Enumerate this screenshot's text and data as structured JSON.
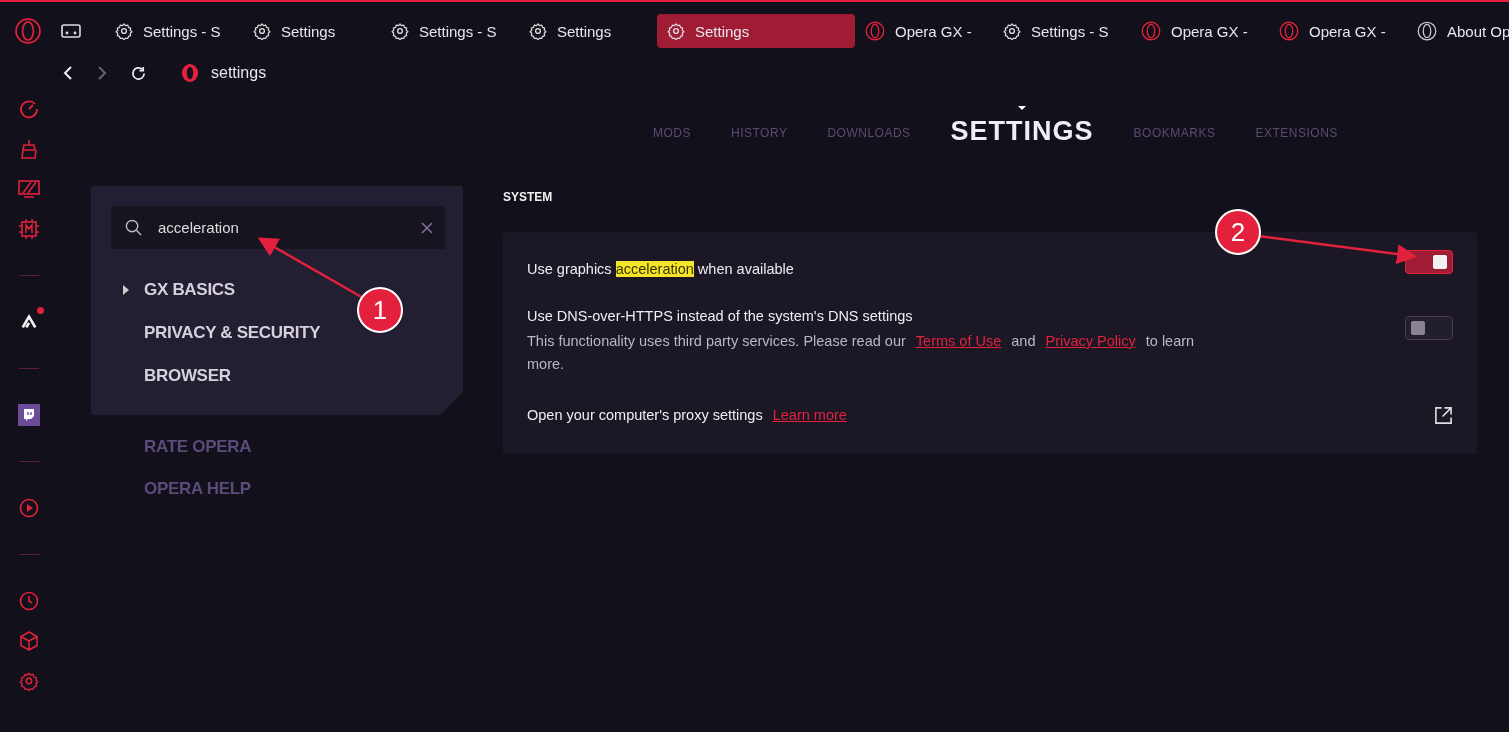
{
  "tabs": [
    {
      "kind": "gear",
      "label": "Settings - S",
      "selected": false
    },
    {
      "kind": "gear",
      "label": "Settings",
      "selected": false
    },
    {
      "kind": "gear",
      "label": "Settings - S",
      "selected": false
    },
    {
      "kind": "gear",
      "label": "Settings",
      "selected": false
    },
    {
      "kind": "gear",
      "label": "Settings",
      "selected": true
    },
    {
      "kind": "opera",
      "label": "Opera GX -",
      "selected": false
    },
    {
      "kind": "gear",
      "label": "Settings - S",
      "selected": false
    },
    {
      "kind": "opera",
      "label": "Opera GX -",
      "selected": false
    },
    {
      "kind": "opera",
      "label": "Opera GX -",
      "selected": false
    },
    {
      "kind": "about",
      "label": "About Op",
      "selected": false
    }
  ],
  "address": {
    "text": "settings"
  },
  "sidebar": [
    {
      "kind": "speed"
    },
    {
      "kind": "cleaner"
    },
    {
      "kind": "display"
    },
    {
      "kind": "ram"
    },
    {
      "kind": "divider"
    },
    {
      "kind": "arrow",
      "badge": true
    },
    {
      "kind": "divider"
    },
    {
      "kind": "twitch"
    },
    {
      "kind": "divider"
    },
    {
      "kind": "player"
    },
    {
      "kind": "divider"
    },
    {
      "kind": "clock"
    },
    {
      "kind": "cube"
    },
    {
      "kind": "gear"
    }
  ],
  "settings_nav": [
    {
      "label": "MODS",
      "selected": false
    },
    {
      "label": "HISTORY",
      "selected": false
    },
    {
      "label": "DOWNLOADS",
      "selected": false
    },
    {
      "label": "SETTINGS",
      "selected": true
    },
    {
      "label": "BOOKMARKS",
      "selected": false
    },
    {
      "label": "EXTENSIONS",
      "selected": false
    }
  ],
  "search": {
    "value": "acceleration"
  },
  "sections": [
    {
      "label": "GX BASICS",
      "expandable": true
    },
    {
      "label": "PRIVACY & SECURITY",
      "expandable": false
    },
    {
      "label": "BROWSER",
      "expandable": false
    }
  ],
  "links": [
    "RATE OPERA",
    "OPERA HELP"
  ],
  "system": {
    "title": "SYSTEM",
    "rows": [
      {
        "kind": "toggle",
        "label": {
          "before": "Use graphics ",
          "highlight": "acceleration",
          "after": " when available"
        },
        "on": true
      },
      {
        "kind": "toggle",
        "label": {
          "before": "Use DNS-over-HTTPS instead of the system's DNS settings"
        },
        "description": [
          {
            "kind": "text",
            "text": "This functionality uses third party services. Please read our "
          },
          {
            "kind": "link",
            "text": "Terms of Use"
          },
          {
            "kind": "text",
            "text": " and "
          },
          {
            "kind": "link",
            "text": "Privacy Policy"
          },
          {
            "kind": "text",
            "text": " to learn more."
          }
        ],
        "on": false
      },
      {
        "kind": "external",
        "label": {
          "before": "Open your computer's proxy settings"
        },
        "link": "Learn more"
      }
    ]
  },
  "callouts": [
    "1",
    "2"
  ]
}
